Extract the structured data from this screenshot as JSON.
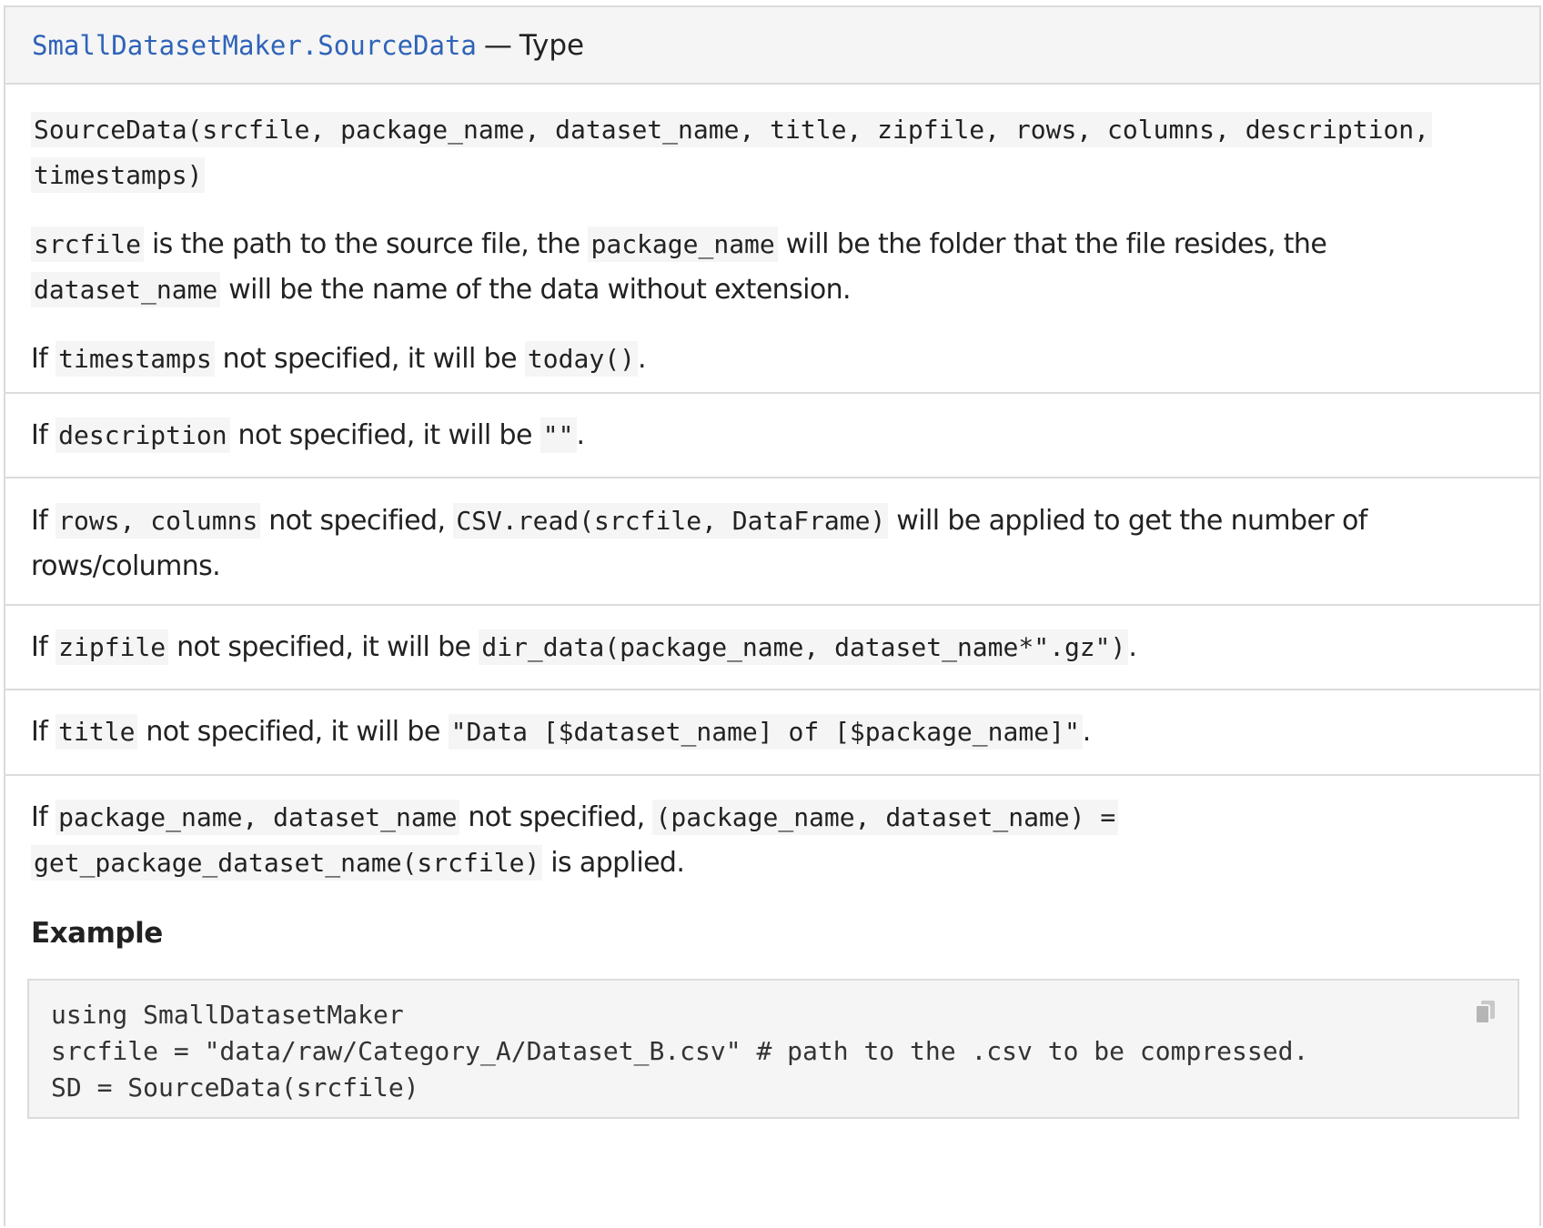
{
  "header": {
    "binding": "SmallDatasetMaker.SourceData",
    "separator": "—",
    "category": "Type"
  },
  "signature": {
    "line1": "SourceData(srcfile, package_name, dataset_name, title, zipfile, rows, columns, description,",
    "line2": "timestamps)"
  },
  "desc1": {
    "c1": "srcfile",
    "t1": " is the path to the source file, the ",
    "c2": "package_name",
    "t2": " will be the folder that the file resides, the",
    "c3": "dataset_name",
    "t3": " will be the name of the data without extension."
  },
  "desc2": {
    "t1": "If ",
    "c1": "timestamps",
    "t2": " not specified, it will be ",
    "c2": "today()",
    "t3": "."
  },
  "desc3": {
    "t1": "If ",
    "c1": "description",
    "t2": " not specified, it will be ",
    "c2": "\"\"",
    "t3": "."
  },
  "desc4": {
    "t1": "If ",
    "c1": "rows, columns",
    "t2": " not specified, ",
    "c2": "CSV.read(srcfile, DataFrame)",
    "t3": " will be applied to get the number of",
    "t4": "rows/columns."
  },
  "desc5": {
    "t1": "If ",
    "c1": "zipfile",
    "t2": " not specified, it will be ",
    "c2": "dir_data(package_name, dataset_name*\".gz\")",
    "t3": "."
  },
  "desc6": {
    "t1": "If ",
    "c1": "title",
    "t2": " not specified, it will be ",
    "c2": "\"Data [$dataset_name] of [$package_name]\"",
    "t3": "."
  },
  "desc7": {
    "t1": "If ",
    "c1": "package_name, dataset_name",
    "t2": " not specified, ",
    "c2": "(package_name, dataset_name) =",
    "c3": "get_package_dataset_name(srcfile)",
    "t3": " is applied."
  },
  "example": {
    "heading": "Example",
    "code_line1": "using SmallDatasetMaker",
    "code_line2": "srcfile = \"data/raw/Category_A/Dataset_B.csv\" # path to the .csv to be compressed.",
    "code_line3": "SD = SourceData(srcfile)",
    "copy_icon": "copy-icon"
  }
}
